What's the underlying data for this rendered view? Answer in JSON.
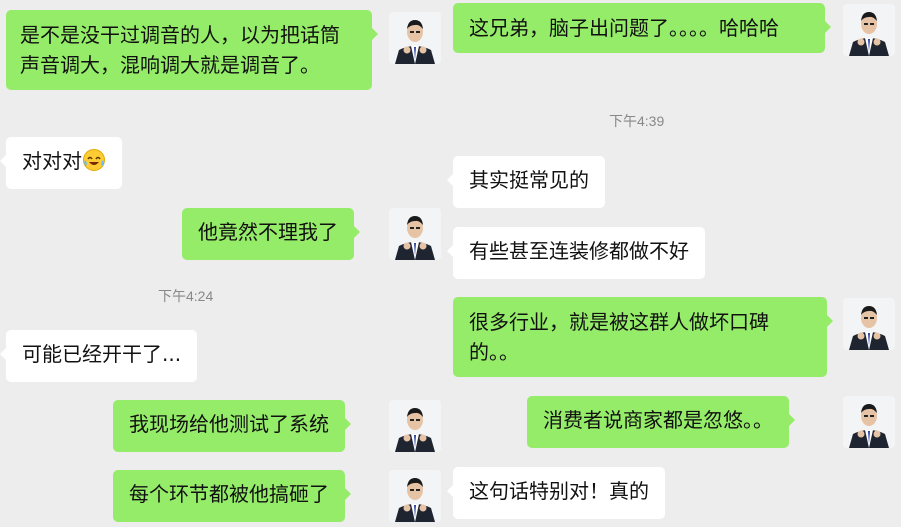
{
  "colors": {
    "background": "#ededed",
    "sent_bubble": "#95ec69",
    "received_bubble": "#ffffff",
    "timestamp_text": "#888888"
  },
  "left_panel": {
    "messages": [
      {
        "direction": "sent",
        "text": "是不是没干过调音的人，以为把话筒声音调大，混响调大就是调音了。",
        "avatar_icon": "user-avatar-icon"
      },
      {
        "direction": "received",
        "text": "对对对",
        "emoji_icon": "laughing-tears-emoji-icon"
      },
      {
        "direction": "sent",
        "text": "他竟然不理我了",
        "avatar_icon": "user-avatar-icon"
      },
      {
        "direction": "timestamp",
        "text": "下午4:24"
      },
      {
        "direction": "received",
        "text": "可能已经开干了..."
      },
      {
        "direction": "sent",
        "text": "我现场给他测试了系统",
        "avatar_icon": "user-avatar-icon"
      },
      {
        "direction": "sent",
        "text": "每个环节都被他搞砸了",
        "avatar_icon": "user-avatar-icon"
      }
    ]
  },
  "right_panel": {
    "messages": [
      {
        "direction": "sent",
        "text": "这兄弟，脑子出问题了。。。。哈哈哈",
        "avatar_icon": "user-avatar-icon"
      },
      {
        "direction": "timestamp",
        "text": "下午4:39"
      },
      {
        "direction": "received",
        "text": "其实挺常见的"
      },
      {
        "direction": "received",
        "text": "有些甚至连装修都做不好"
      },
      {
        "direction": "sent",
        "text": "很多行业，就是被这群人做坏口碑的。。",
        "avatar_icon": "user-avatar-icon"
      },
      {
        "direction": "sent",
        "text": "消费者说商家都是忽悠。。",
        "avatar_icon": "user-avatar-icon"
      },
      {
        "direction": "received",
        "text": "这句话特别对！真的"
      }
    ]
  }
}
